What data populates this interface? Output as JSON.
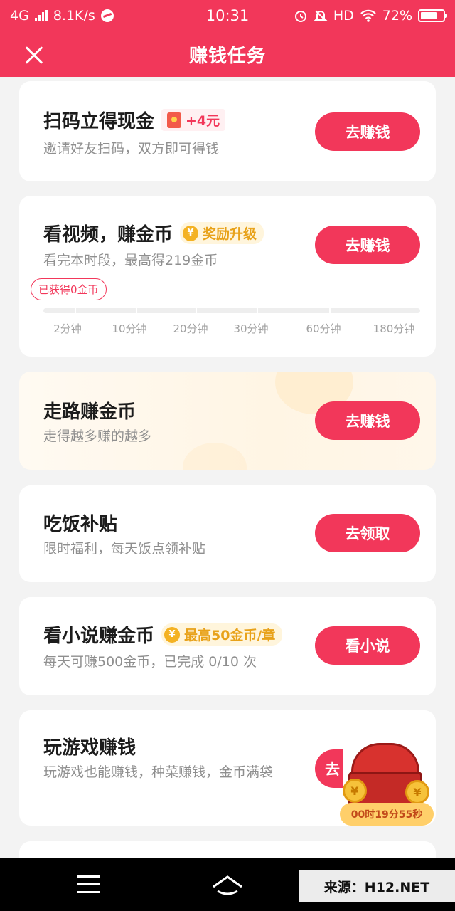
{
  "status_bar": {
    "network": "4G",
    "speed": "8.1K/s",
    "time": "10:31",
    "hd": "HD",
    "battery": "72%",
    "battery_level": 0.72
  },
  "header": {
    "title": "赚钱任务",
    "close_icon": "close-icon"
  },
  "tasks": [
    {
      "title": "扫码立得现金",
      "badge": "+4元",
      "badge_icon": "red-packet-icon",
      "subtitle": "邀请好友扫码，双方即可得钱",
      "button": "去赚钱"
    },
    {
      "title": "看视频，赚金币",
      "badge": "奖励升级",
      "badge_icon": "coin-icon",
      "coin_symbol": "¥",
      "subtitle": "看完本时段，最高得219金币",
      "button": "去赚钱",
      "earned_label": "已获得0金币",
      "progress": 0,
      "milestones": [
        "2分钟",
        "10分钟",
        "20分钟",
        "30分钟",
        "60分钟",
        "180分钟"
      ]
    },
    {
      "title": "走路赚金币",
      "subtitle": "走得越多赚的越多",
      "button": "去赚钱"
    },
    {
      "title": "吃饭补贴",
      "subtitle": "限时福利，每天饭点领补贴",
      "button": "去领取"
    },
    {
      "title": "看小说赚金币",
      "badge": "最高50金币/章",
      "badge_icon": "coin-icon",
      "coin_symbol": "¥",
      "subtitle": "每天可赚500金币，已完成 0/10 次",
      "button": "看小说"
    },
    {
      "title": "玩游戏赚钱",
      "subtitle": "玩游戏也能赚钱，种菜赚钱，金币满袋",
      "button": "去"
    }
  ],
  "floating_widget": {
    "icon": "treasure-chest-icon",
    "timer": "00时19分55秒"
  },
  "nav_bar": {
    "menu_icon": "menu-icon",
    "home_icon": "home-icon"
  },
  "watermark": "来源：H12.NET",
  "colors": {
    "accent": "#f2375a",
    "gold": "#f4b223",
    "background": "#f3f3f3"
  }
}
